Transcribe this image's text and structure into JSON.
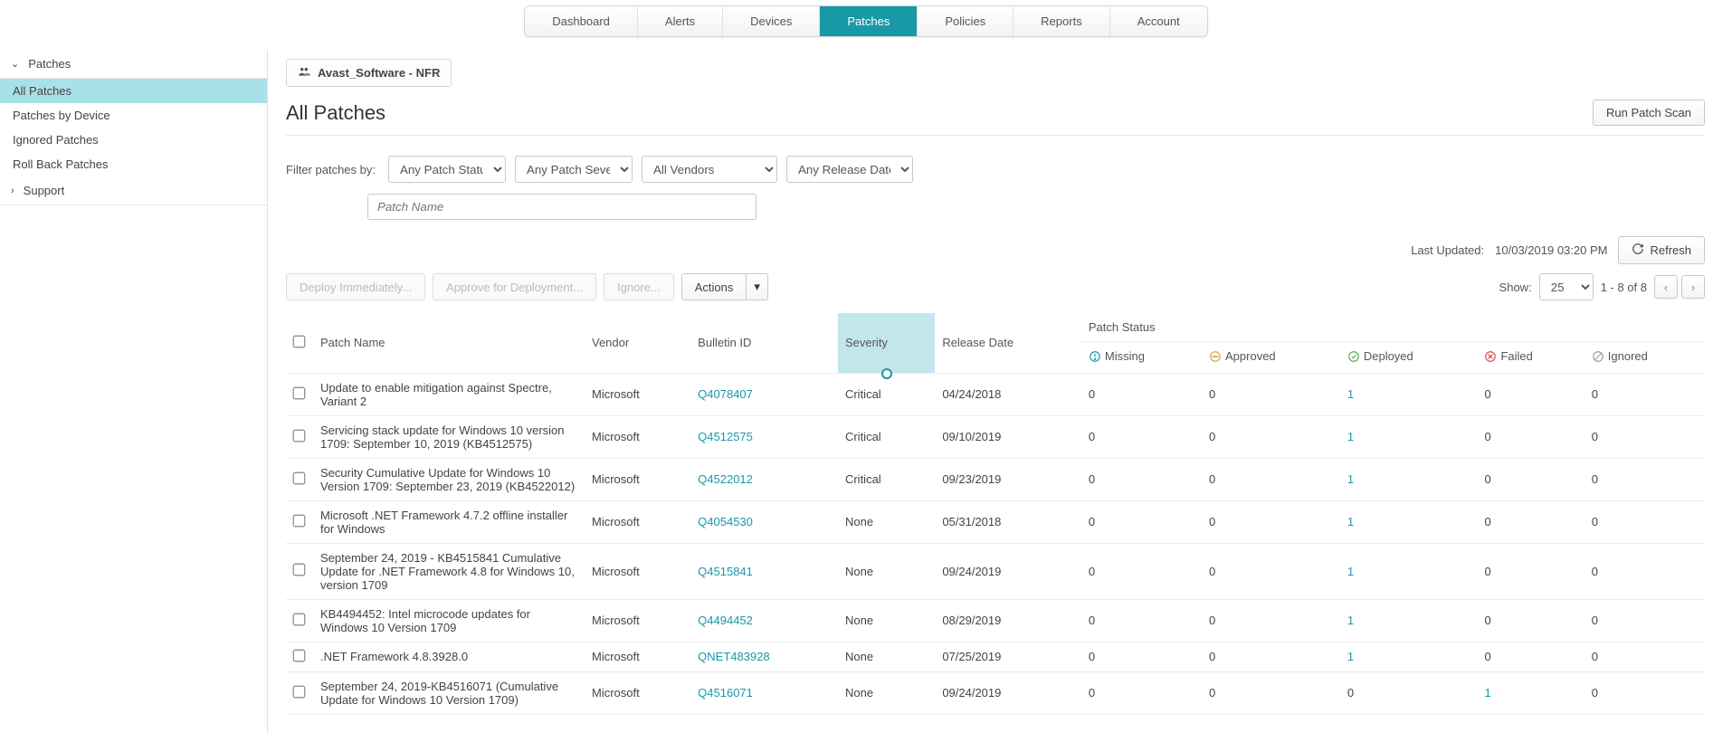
{
  "topnav": {
    "items": [
      "Dashboard",
      "Alerts",
      "Devices",
      "Patches",
      "Policies",
      "Reports",
      "Account"
    ],
    "active_index": 3
  },
  "sidebar": {
    "sections": [
      {
        "title": "Patches",
        "expanded": true,
        "items": [
          "All Patches",
          "Patches by Device",
          "Ignored Patches",
          "Roll Back Patches"
        ],
        "active_index": 0
      },
      {
        "title": "Support",
        "expanded": false,
        "items": []
      }
    ]
  },
  "main": {
    "group_name": "Avast_Software - NFR",
    "page_title": "All Patches",
    "run_scan_label": "Run Patch Scan",
    "filter_label": "Filter patches by:",
    "filters": {
      "status": "Any Patch Status",
      "severity": "Any Patch Severity",
      "vendor": "All Vendors",
      "release": "Any Release Date",
      "patch_name_placeholder": "Patch Name"
    },
    "last_updated_label": "Last Updated:",
    "last_updated_value": "10/03/2019 03:20 PM",
    "refresh_label": "Refresh",
    "action_buttons": {
      "deploy": "Deploy Immediately...",
      "approve": "Approve for Deployment...",
      "ignore": "Ignore...",
      "actions": "Actions"
    },
    "show_label": "Show:",
    "show_value": "25",
    "range_label": "1 - 8 of 8",
    "columns": {
      "patch_name": "Patch Name",
      "vendor": "Vendor",
      "bulletin": "Bulletin ID",
      "severity": "Severity",
      "release": "Release Date",
      "status_group": "Patch Status",
      "missing": "Missing",
      "approved": "Approved",
      "deployed": "Deployed",
      "failed": "Failed",
      "ignored": "Ignored"
    },
    "rows": [
      {
        "name": "Update to enable mitigation against Spectre, Variant 2",
        "vendor": "Microsoft",
        "bulletin": "Q4078407",
        "severity": "Critical",
        "release": "04/24/2018",
        "missing": 0,
        "approved": 0,
        "deployed": 1,
        "failed": 0,
        "ignored": 0
      },
      {
        "name": "Servicing stack update for Windows 10 version 1709: September 10, 2019 (KB4512575)",
        "vendor": "Microsoft",
        "bulletin": "Q4512575",
        "severity": "Critical",
        "release": "09/10/2019",
        "missing": 0,
        "approved": 0,
        "deployed": 1,
        "failed": 0,
        "ignored": 0
      },
      {
        "name": "Security Cumulative Update for Windows 10 Version 1709: September 23, 2019 (KB4522012)",
        "vendor": "Microsoft",
        "bulletin": "Q4522012",
        "severity": "Critical",
        "release": "09/23/2019",
        "missing": 0,
        "approved": 0,
        "deployed": 1,
        "failed": 0,
        "ignored": 0
      },
      {
        "name": "Microsoft .NET Framework 4.7.2 offline installer for Windows",
        "vendor": "Microsoft",
        "bulletin": "Q4054530",
        "severity": "None",
        "release": "05/31/2018",
        "missing": 0,
        "approved": 0,
        "deployed": 1,
        "failed": 0,
        "ignored": 0
      },
      {
        "name": "September 24, 2019 - KB4515841 Cumulative Update for .NET Framework 4.8 for Windows 10, version 1709",
        "vendor": "Microsoft",
        "bulletin": "Q4515841",
        "severity": "None",
        "release": "09/24/2019",
        "missing": 0,
        "approved": 0,
        "deployed": 1,
        "failed": 0,
        "ignored": 0
      },
      {
        "name": "KB4494452: Intel microcode updates for Windows 10 Version 1709",
        "vendor": "Microsoft",
        "bulletin": "Q4494452",
        "severity": "None",
        "release": "08/29/2019",
        "missing": 0,
        "approved": 0,
        "deployed": 1,
        "failed": 0,
        "ignored": 0
      },
      {
        "name": ".NET Framework 4.8.3928.0",
        "vendor": "Microsoft",
        "bulletin": "QNET483928",
        "severity": "None",
        "release": "07/25/2019",
        "missing": 0,
        "approved": 0,
        "deployed": 1,
        "failed": 0,
        "ignored": 0
      },
      {
        "name": "September 24, 2019-KB4516071 (Cumulative Update for Windows 10 Version 1709)",
        "vendor": "Microsoft",
        "bulletin": "Q4516071",
        "severity": "None",
        "release": "09/24/2019",
        "missing": 0,
        "approved": 0,
        "deployed": 0,
        "failed": 1,
        "ignored": 0
      }
    ],
    "status_colors": {
      "missing": "#1998a7",
      "approved": "#d7a531",
      "deployed": "#4fae5b",
      "failed": "#d64b4b",
      "ignored": "#9b9b9b"
    }
  }
}
